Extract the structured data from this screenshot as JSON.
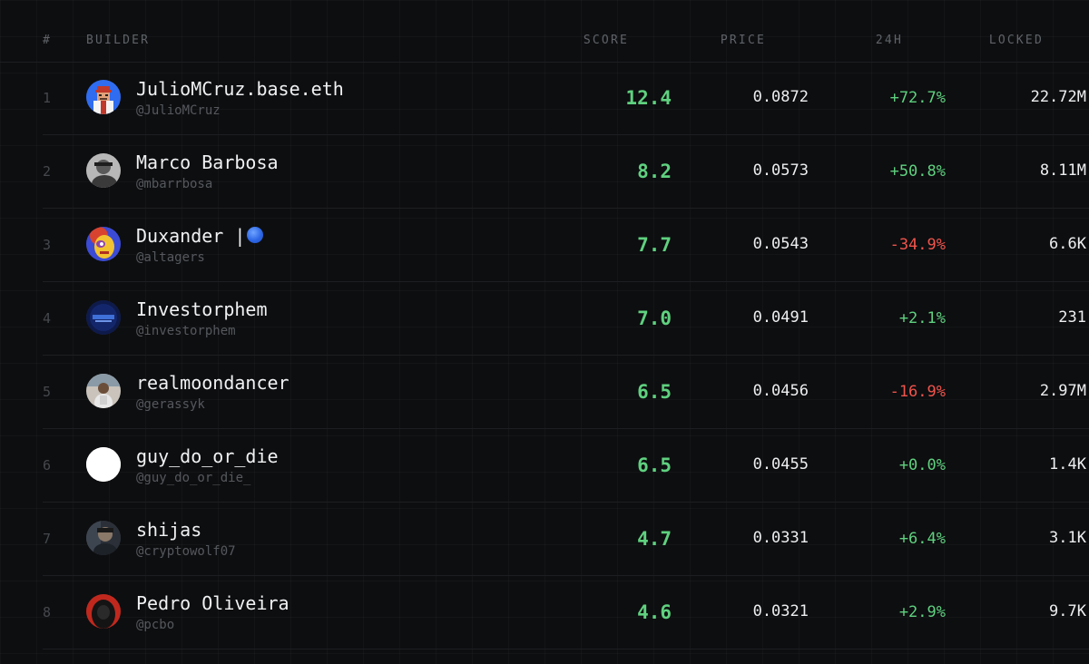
{
  "header": {
    "rank": "#",
    "builder": "BUILDER",
    "score": "SCORE",
    "price": "PRICE",
    "change": "24H",
    "locked": "LOCKED"
  },
  "rows": [
    {
      "rank": "1",
      "name": "JulioMCruz.base.eth",
      "handle": "@JulioMCruz",
      "score": "12.4",
      "price": "0.0872",
      "change": "+72.7%",
      "locked": "22.72M",
      "avatar": "pixel-avatar-icon"
    },
    {
      "rank": "2",
      "name": "Marco Barbosa",
      "handle": "@mbarrbosa",
      "score": "8.2",
      "price": "0.0573",
      "change": "+50.8%",
      "locked": "8.11M",
      "avatar": "photo-avatar-icon"
    },
    {
      "rank": "3",
      "name": "Duxander |",
      "handle": "@altagers",
      "score": "7.7",
      "price": "0.0543",
      "change": "-34.9%",
      "locked": "6.6K",
      "avatar": "cartoon-avatar-icon"
    },
    {
      "rank": "4",
      "name": "Investorphem",
      "handle": "@investorphem",
      "score": "7.0",
      "price": "0.0491",
      "change": "+2.1%",
      "locked": "231",
      "avatar": "logo-avatar-icon"
    },
    {
      "rank": "5",
      "name": "realmoondancer",
      "handle": "@gerassyk",
      "score": "6.5",
      "price": "0.0456",
      "change": "-16.9%",
      "locked": "2.97M",
      "avatar": "photo-avatar-icon"
    },
    {
      "rank": "6",
      "name": "guy_do_or_die",
      "handle": "@guy_do_or_die_",
      "score": "6.5",
      "price": "0.0455",
      "change": "+0.0%",
      "locked": "1.4K",
      "avatar": "blank-avatar-icon"
    },
    {
      "rank": "7",
      "name": "shijas",
      "handle": "@cryptowolf07",
      "score": "4.7",
      "price": "0.0331",
      "change": "+6.4%",
      "locked": "3.1K",
      "avatar": "photo-avatar-icon"
    },
    {
      "rank": "8",
      "name": "Pedro Oliveira",
      "handle": "@pcbo",
      "score": "4.6",
      "price": "0.0321",
      "change": "+2.9%",
      "locked": "9.7K",
      "avatar": "hooded-avatar-icon"
    }
  ],
  "colors": {
    "background": "#0d0e10",
    "positive": "#5fd17f",
    "negative": "#f0544c",
    "badge": "#2d67e6"
  }
}
